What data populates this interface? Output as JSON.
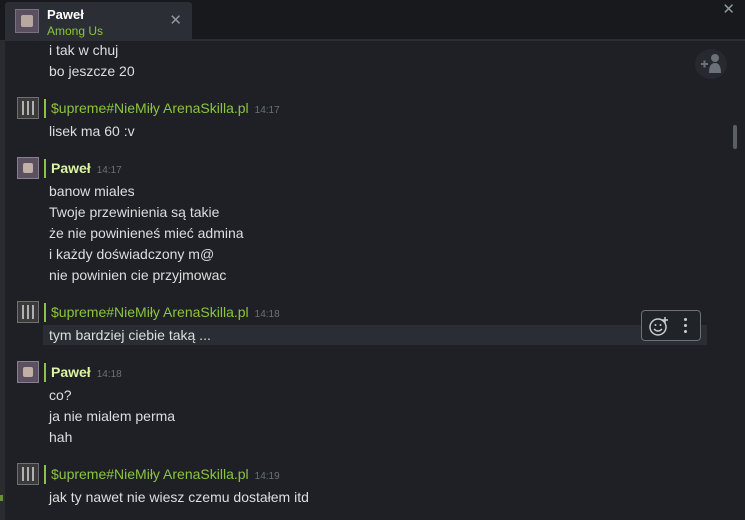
{
  "tab": {
    "name": "Paweł",
    "game": "Among Us",
    "close_glyph": "✕"
  },
  "window": {
    "close_glyph": "✕"
  },
  "colors": {
    "friend_name": "#dcf5a0",
    "ingame_name": "#8bc53f",
    "timestamp": "#6b7178"
  },
  "messages": [
    {
      "lines": [
        "i tak w chuj",
        "bo jeszcze 20"
      ]
    },
    {
      "sender": "$upreme#NieMiły ArenaSkilla.pl",
      "time": "14:17",
      "lines": [
        "lisek ma 60 :v"
      ]
    },
    {
      "sender": "Paweł",
      "time": "14:17",
      "lines": [
        "banow miales",
        "Twoje przewinienia są takie",
        "że nie powinieneś mieć admina",
        "i każdy doświadczony m@",
        "nie powinien cie przyjmowac"
      ]
    },
    {
      "sender": "$upreme#NieMiły ArenaSkilla.pl",
      "time": "14:18",
      "lines": [
        "tym bardziej ciebie taką ..."
      ]
    },
    {
      "sender": "Paweł",
      "time": "14:18",
      "lines": [
        "co?",
        "ja nie mialem perma",
        "hah"
      ]
    },
    {
      "sender": "$upreme#NieMiły ArenaSkilla.pl",
      "time": "14:19",
      "lines": [
        "jak ty nawet nie wiesz czemu dostałem itd"
      ]
    }
  ],
  "icons": [
    "add-reaction-icon",
    "more-options-icon",
    "add-friend-icon",
    "close-icon"
  ]
}
